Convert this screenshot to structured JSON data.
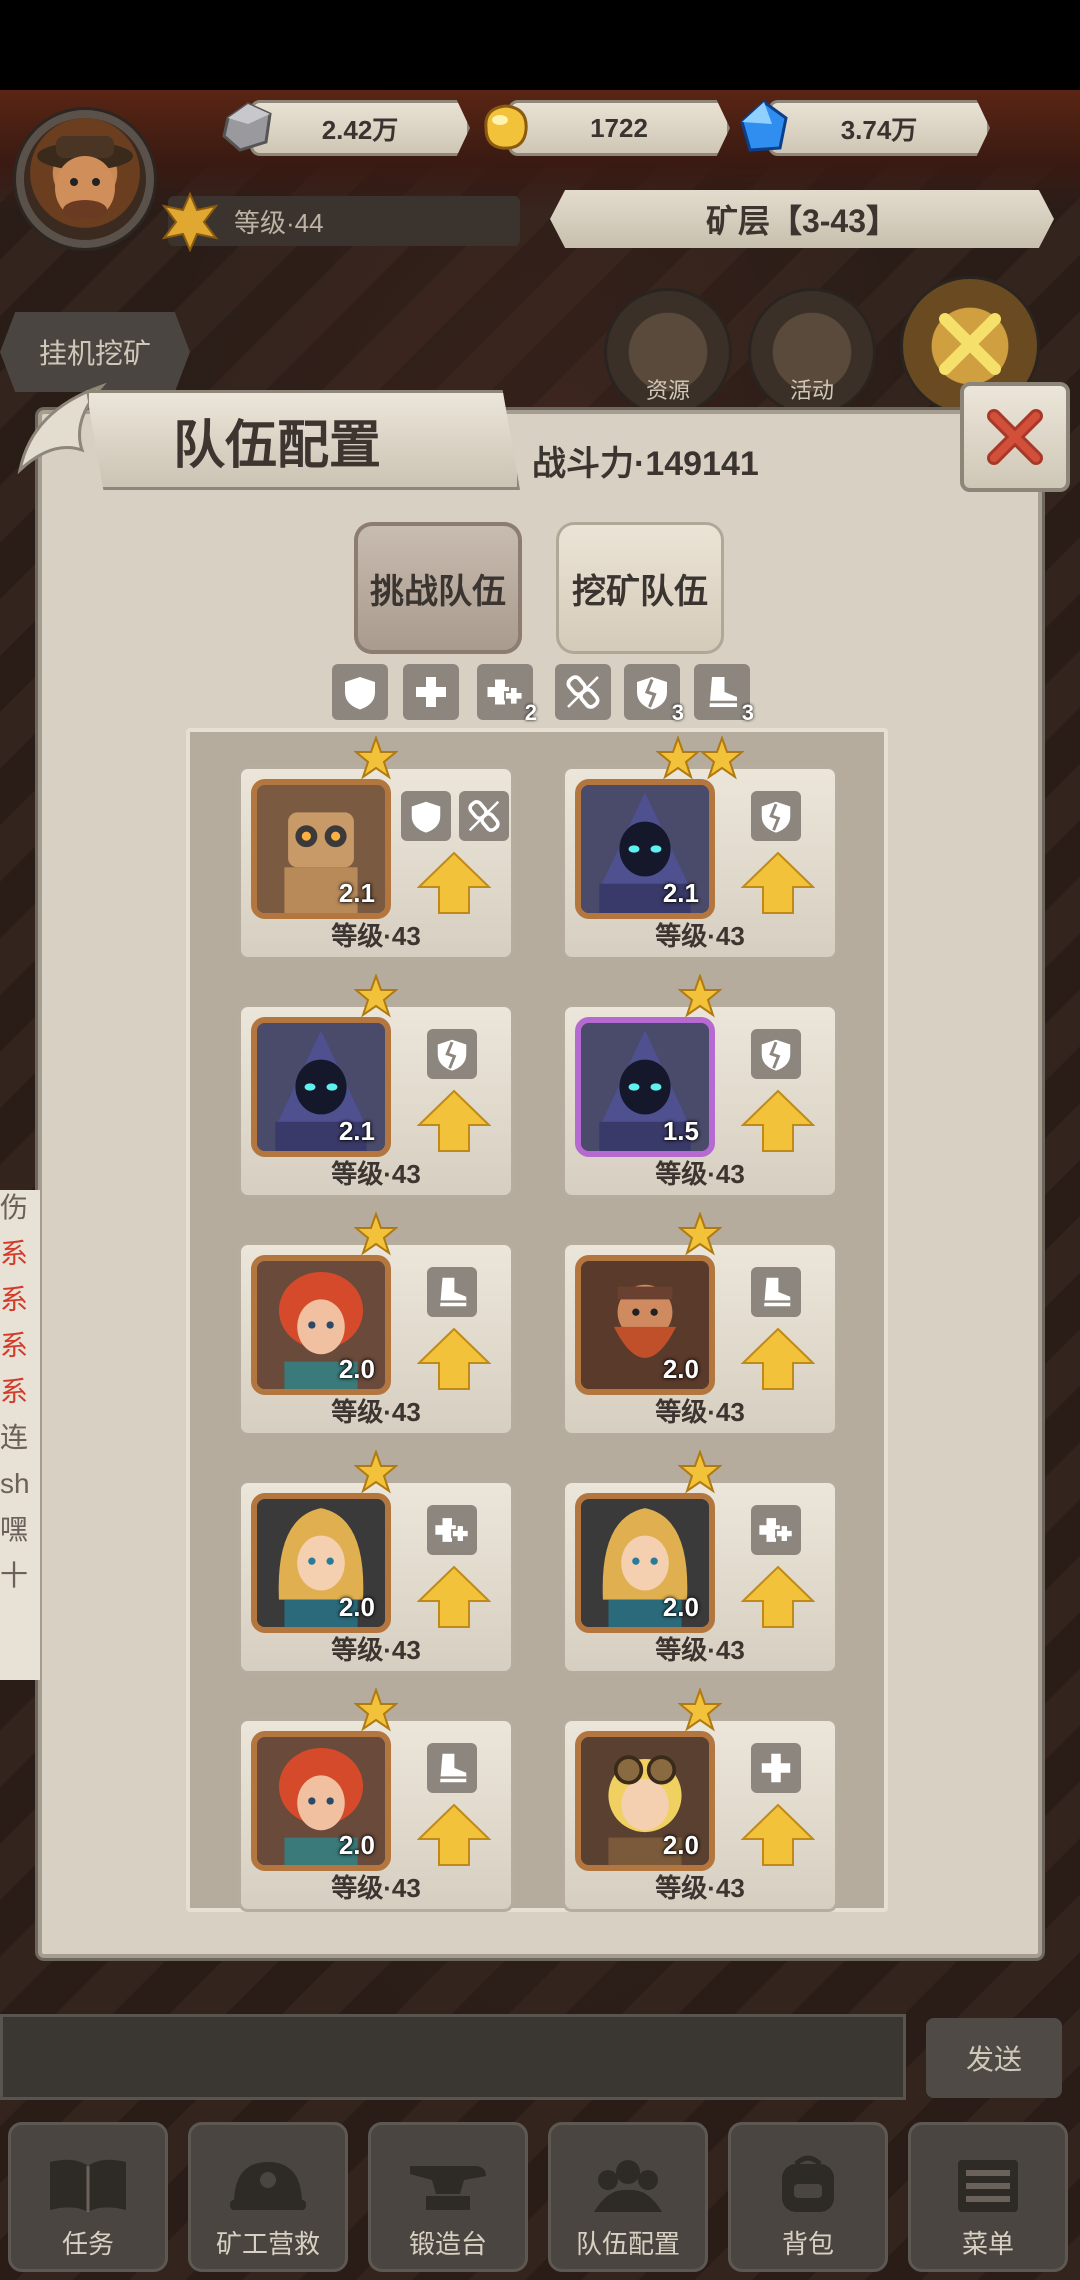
{
  "resources": [
    {
      "name": "stone",
      "value": "2.42万"
    },
    {
      "name": "gold",
      "value": "1722"
    },
    {
      "name": "diamond",
      "value": "3.74万"
    }
  ],
  "player": {
    "level": "等级·44"
  },
  "mine_layer": "矿层【3-43】",
  "side_tab": "挂机挖矿",
  "shortcuts": [
    {
      "label": "资源"
    },
    {
      "label": "活动"
    }
  ],
  "panel": {
    "title": "队伍配置",
    "power": "战斗力·149141",
    "tabs": [
      {
        "label": "挑战队伍",
        "active": true
      },
      {
        "label": "挖矿队伍",
        "active": false
      }
    ]
  },
  "buffs": [
    {
      "icon": "shield-icon",
      "sub": ""
    },
    {
      "icon": "plus-icon",
      "sub": ""
    },
    {
      "icon": "double-plus-icon",
      "sub": "2"
    },
    {
      "icon": "broken-link-icon",
      "sub": ""
    },
    {
      "icon": "cracked-shield-icon",
      "sub": "3"
    },
    {
      "icon": "boot-icon",
      "sub": "3"
    }
  ],
  "heroes": [
    {
      "stars": 1,
      "value": "2.1",
      "level": "等级·43",
      "portrait": "robot",
      "frame": "bronze",
      "skills": [
        "shield-icon",
        "broken-link-icon"
      ]
    },
    {
      "stars": 2,
      "value": "2.1",
      "level": "等级·43",
      "portrait": "hooded",
      "frame": "bronze",
      "skills": [
        "cracked-shield-icon"
      ]
    },
    {
      "stars": 1,
      "value": "2.1",
      "level": "等级·43",
      "portrait": "hooded",
      "frame": "bronze",
      "skills": [
        "cracked-shield-icon"
      ]
    },
    {
      "stars": 1,
      "value": "1.5",
      "level": "等级·43",
      "portrait": "hooded",
      "frame": "purple",
      "skills": [
        "cracked-shield-icon"
      ]
    },
    {
      "stars": 1,
      "value": "2.0",
      "level": "等级·43",
      "portrait": "redhair",
      "frame": "bronze",
      "skills": [
        "boot-icon"
      ]
    },
    {
      "stars": 1,
      "value": "2.0",
      "level": "等级·43",
      "portrait": "dwarf",
      "frame": "bronze",
      "skills": [
        "boot-icon"
      ]
    },
    {
      "stars": 1,
      "value": "2.0",
      "level": "等级·43",
      "portrait": "blonde",
      "frame": "bronze",
      "skills": [
        "double-plus-icon"
      ]
    },
    {
      "stars": 1,
      "value": "2.0",
      "level": "等级·43",
      "portrait": "blonde",
      "frame": "bronze",
      "skills": [
        "double-plus-icon"
      ]
    },
    {
      "stars": 1,
      "value": "2.0",
      "level": "等级·43",
      "portrait": "redhair",
      "frame": "bronze",
      "skills": [
        "boot-icon"
      ]
    },
    {
      "stars": 1,
      "value": "2.0",
      "level": "等级·43",
      "portrait": "goggles",
      "frame": "bronze",
      "skills": [
        "plus-icon"
      ]
    }
  ],
  "chat_fragments": [
    "伤",
    "系",
    "系",
    "系",
    "系",
    "连",
    "sh",
    "嘿",
    "十"
  ],
  "chat": {
    "send": "发送"
  },
  "nav": [
    {
      "label": "任务",
      "icon": "book-icon"
    },
    {
      "label": "矿工营救",
      "icon": "helmet-icon"
    },
    {
      "label": "锻造台",
      "icon": "anvil-icon"
    },
    {
      "label": "队伍配置",
      "icon": "team-icon"
    },
    {
      "label": "背包",
      "icon": "backpack-icon"
    },
    {
      "label": "菜单",
      "icon": "menu-icon"
    }
  ],
  "colors": {
    "gold": "#f2c23a",
    "panel": "#d8d1c3",
    "bronze": "#b3763f",
    "purple": "#b56ad1"
  }
}
